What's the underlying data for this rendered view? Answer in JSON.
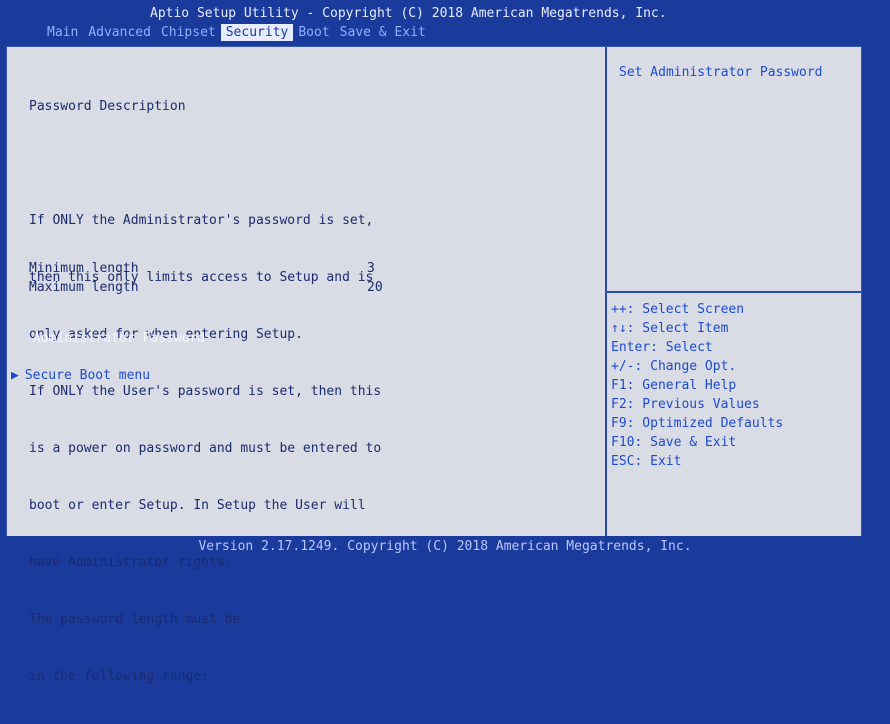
{
  "header": {
    "title": "Aptio Setup Utility - Copyright (C) 2018 American Megatrends, Inc.",
    "tabs": [
      "Main",
      "Advanced",
      "Chipset",
      "Security",
      "Boot",
      "Save & Exit"
    ]
  },
  "left": {
    "heading": "Password Description",
    "lines": [
      "If ONLY the Administrator's password is set,",
      "then this only limits access to Setup and is",
      "only asked for when entering Setup.",
      "If ONLY the User's password is set, then this",
      "is a power on password and must be entered to",
      "boot or enter Setup. In Setup the User will",
      "have Administrator rights.",
      "The password length must be",
      "in the following range:"
    ],
    "min_label": "Minimum length",
    "min_value": "3",
    "max_label": "Maximum length",
    "max_value": "20",
    "admin_password": "Administrator Password",
    "secure_boot": "Secure Boot menu"
  },
  "right": {
    "help": "Set Administrator Password",
    "keys": [
      "++: Select Screen",
      "↑↓: Select Item",
      "Enter: Select",
      "+/-: Change Opt.",
      "F1: General Help",
      "F2: Previous Values",
      "F9: Optimized Defaults",
      "F10: Save & Exit",
      "ESC: Exit"
    ]
  },
  "footer": "Version 2.17.1249. Copyright (C) 2018 American Megatrends, Inc."
}
